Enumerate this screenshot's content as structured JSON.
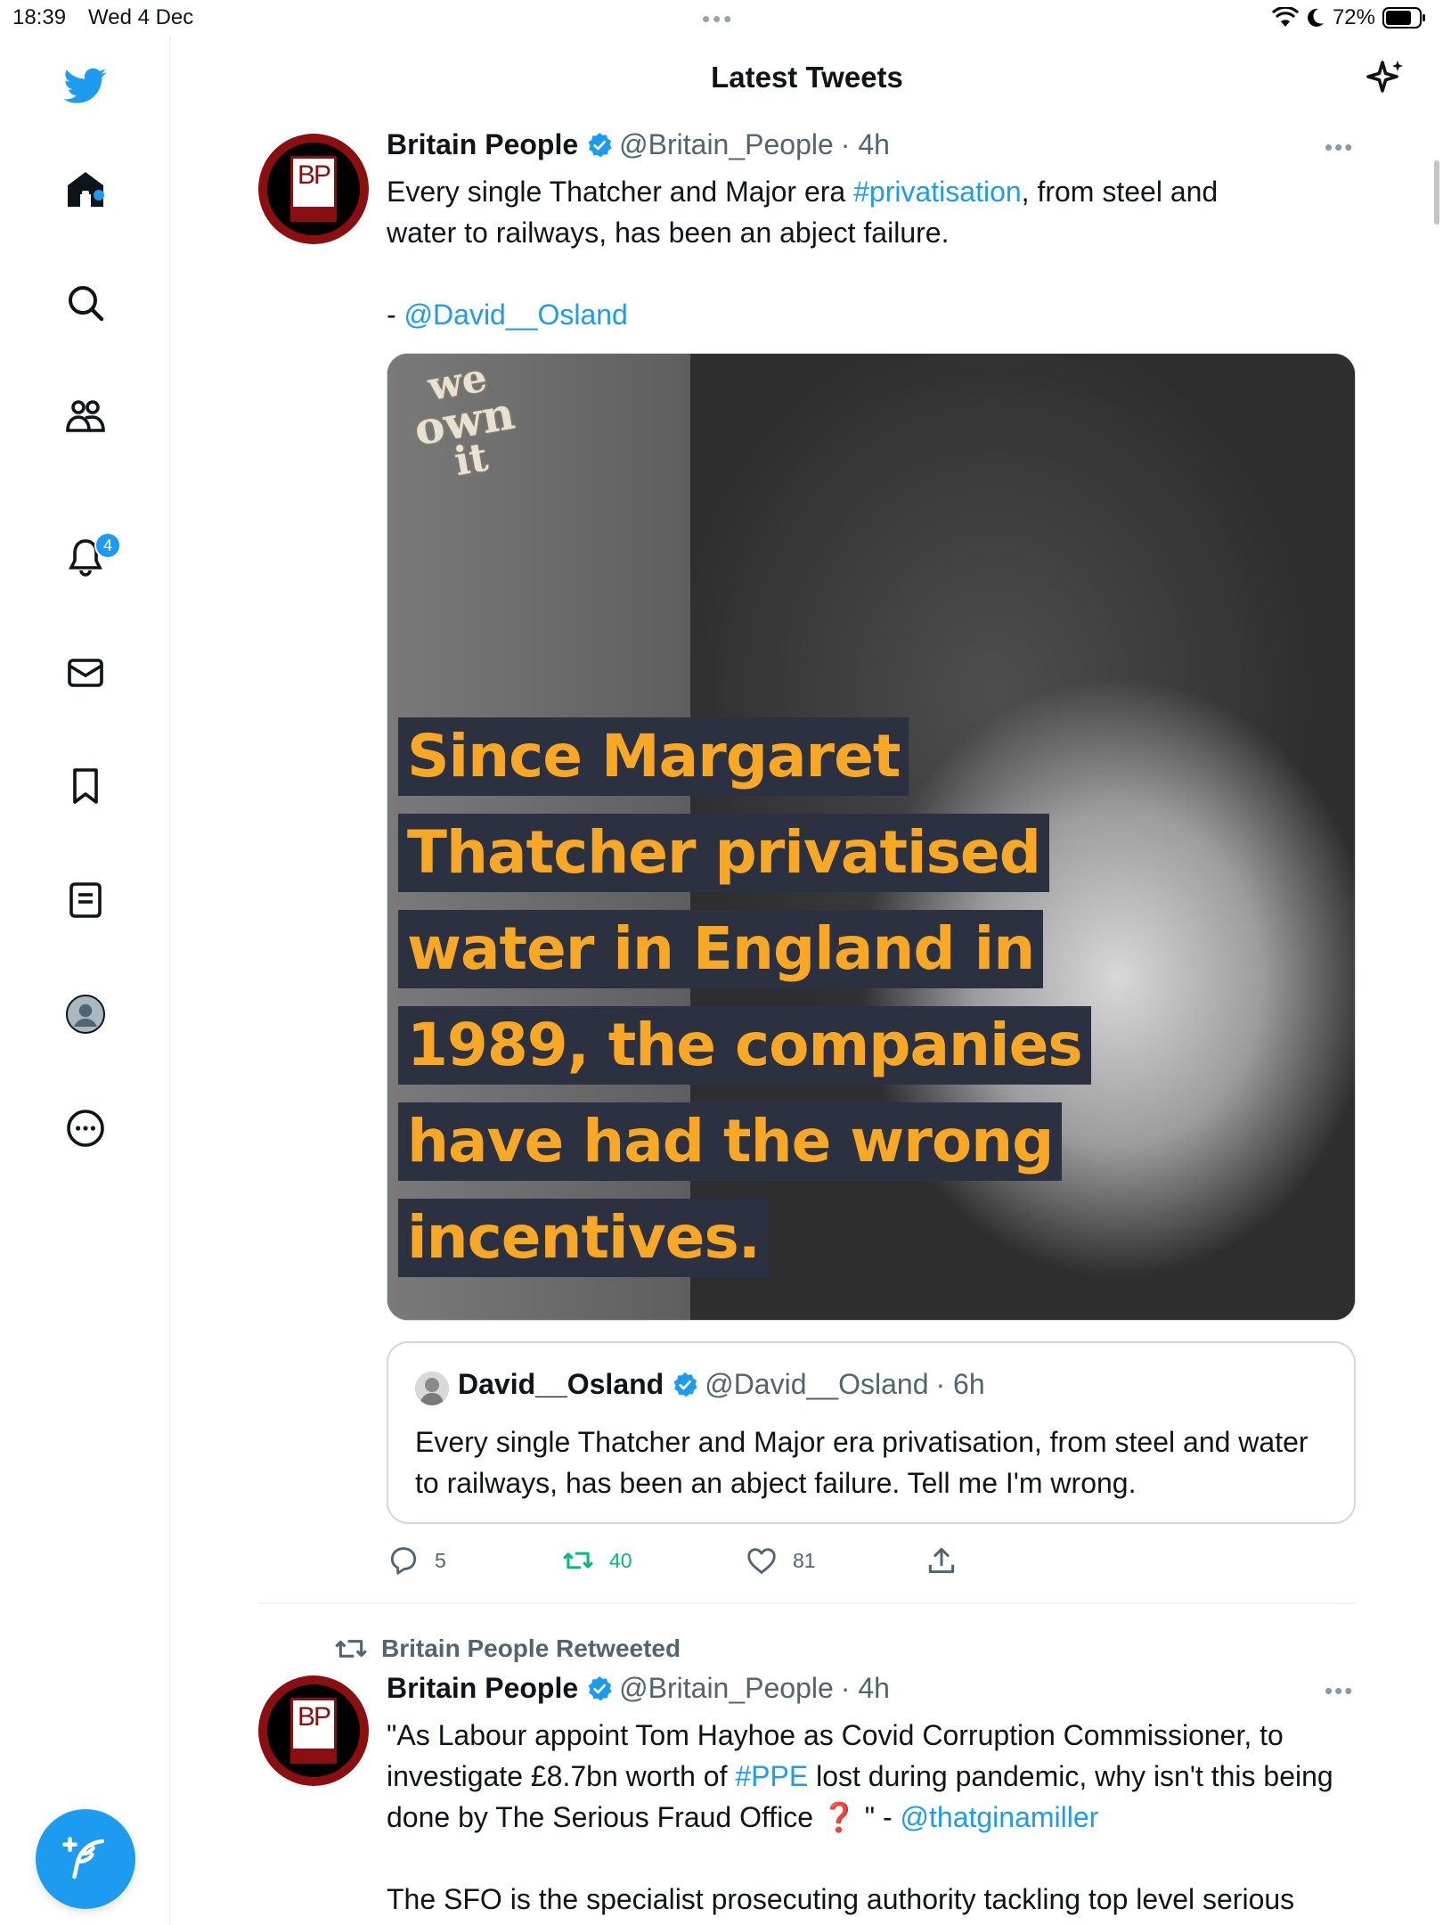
{
  "status_bar": {
    "time": "18:39",
    "date": "Wed 4 Dec",
    "battery": "72%"
  },
  "header": {
    "title": "Latest Tweets"
  },
  "sidebar": {
    "notifications_count": "4",
    "items": [
      "twitter-logo",
      "home-icon",
      "search-icon",
      "communities-icon",
      "notifications-icon",
      "messages-icon",
      "bookmarks-icon",
      "lists-icon",
      "profile-icon",
      "more-icon"
    ]
  },
  "tweet1": {
    "name": "Britain People",
    "handle": "@Britain_People",
    "time": "· 4h",
    "text_a": "Every single Thatcher and Major era ",
    "hashtag": "#privatisation",
    "text_b": ", from steel and\nwater to railways, has been an abject failure.",
    "credit_prefix": "- ",
    "credit_mention": "@David__Osland",
    "avatar_text": "BP",
    "media": {
      "watermark": [
        "we",
        "own",
        "it"
      ],
      "caption_lines": [
        "Since Margaret",
        "Thatcher privatised",
        "water in England in",
        "1989, the companies",
        "have had the wrong",
        "incentives."
      ]
    },
    "quote": {
      "name": "David__Osland",
      "handle": "@David__Osland",
      "time": "· 6h",
      "text": "Every single Thatcher and Major era privatisation, from steel and water to railways, has been an abject failure. Tell me I'm wrong."
    },
    "replies": "5",
    "retweets": "40",
    "likes": "81"
  },
  "tweet2": {
    "retweeted_by": "Britain People Retweeted",
    "name": "Britain People",
    "handle": "@Britain_People",
    "time": "· 4h",
    "avatar_text": "BP",
    "text_a": "\"As Labour appoint Tom Hayhoe as Covid Corruption Commissioner, to investigate £8.7bn worth of ",
    "hashtag": "#PPE",
    "text_b": " lost during pandemic, why isn't this being done by The Serious Fraud Office ",
    "emoji": "❓",
    "text_c": " \" - ",
    "mention": "@thatginamiller",
    "text_d": "The SFO is the specialist prosecuting authority tackling top level serious"
  },
  "colors": {
    "twitter_blue": "#1d9bf0",
    "retweet_green": "#00ba7c",
    "caption_yellow": "#f9a825",
    "caption_bg": "#2b3140",
    "bp_red": "#8b0e10"
  }
}
